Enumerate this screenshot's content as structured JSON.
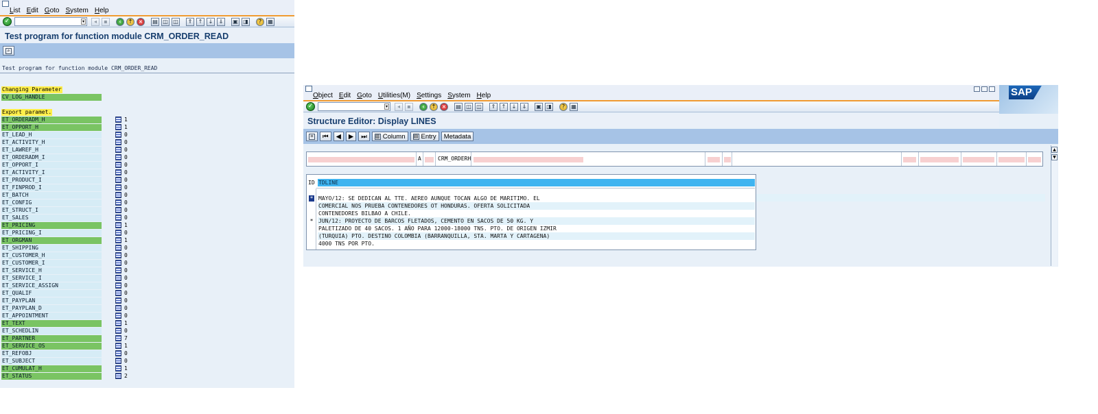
{
  "win1": {
    "menu": [
      "List",
      "Edit",
      "Goto",
      "System",
      "Help"
    ],
    "title": "Test program for function module CRM_ORDER_READ",
    "program_description": "Test program for function module CRM_ORDER_READ",
    "changing_label": "Changing Parameter",
    "changing_params": [
      {
        "name": "CV_LOG_HANDLE",
        "active": true
      }
    ],
    "export_label": "Export paramet.",
    "export_params": [
      {
        "name": "ET_ORDERADM_H",
        "count": "1",
        "active": true
      },
      {
        "name": "ET_OPPORT_H",
        "count": "1",
        "active": true
      },
      {
        "name": "ET_LEAD_H",
        "count": "0",
        "active": false
      },
      {
        "name": "ET_ACTIVITY_H",
        "count": "0",
        "active": false
      },
      {
        "name": "ET_LAWREF_H",
        "count": "0",
        "active": false
      },
      {
        "name": "ET_ORDERADM_I",
        "count": "0",
        "active": false
      },
      {
        "name": "ET_OPPORT_I",
        "count": "0",
        "active": false
      },
      {
        "name": "ET_ACTIVITY_I",
        "count": "0",
        "active": false
      },
      {
        "name": "ET_PRODUCT_I",
        "count": "0",
        "active": false
      },
      {
        "name": "ET_FINPROD_I",
        "count": "0",
        "active": false
      },
      {
        "name": "ET_BATCH",
        "count": "0",
        "active": false
      },
      {
        "name": "ET_CONFIG",
        "count": "0",
        "active": false
      },
      {
        "name": "ET_STRUCT_I",
        "count": "0",
        "active": false
      },
      {
        "name": "ET_SALES",
        "count": "0",
        "active": false
      },
      {
        "name": "ET_PRICING",
        "count": "1",
        "active": true
      },
      {
        "name": "ET_PRICING_I",
        "count": "0",
        "active": false
      },
      {
        "name": "ET_ORGMAN",
        "count": "1",
        "active": true
      },
      {
        "name": "ET_SHIPPING",
        "count": "0",
        "active": false
      },
      {
        "name": "ET_CUSTOMER_H",
        "count": "0",
        "active": false
      },
      {
        "name": "ET_CUSTOMER_I",
        "count": "0",
        "active": false
      },
      {
        "name": "ET_SERVICE_H",
        "count": "0",
        "active": false
      },
      {
        "name": "ET_SERVICE_I",
        "count": "0",
        "active": false
      },
      {
        "name": "ET_SERVICE_ASSIGN",
        "count": "0",
        "active": false
      },
      {
        "name": "ET_QUALIF",
        "count": "0",
        "active": false
      },
      {
        "name": "ET_PAYPLAN",
        "count": "0",
        "active": false
      },
      {
        "name": "ET_PAYPLAN_D",
        "count": "0",
        "active": false
      },
      {
        "name": "ET_APPOINTMENT",
        "count": "0",
        "active": false
      },
      {
        "name": "ET_TEXT",
        "count": "1",
        "active": true
      },
      {
        "name": "ET_SCHEDLIN",
        "count": "0",
        "active": false
      },
      {
        "name": "ET_PARTNER",
        "count": "7",
        "active": true
      },
      {
        "name": "ET_SERVICE_OS",
        "count": "1",
        "active": true
      },
      {
        "name": "ET_REFOBJ",
        "count": "0",
        "active": false
      },
      {
        "name": "ET_SUBJECT",
        "count": "0",
        "active": false
      },
      {
        "name": "ET_CUMULAT_H",
        "count": "1",
        "active": true
      },
      {
        "name": "ET_STATUS",
        "count": "2",
        "active": true
      }
    ]
  },
  "win2": {
    "menu": [
      "Object",
      "Edit",
      "Goto",
      "Utilities(M)",
      "Settings",
      "System",
      "Help"
    ],
    "logo_text": "SAP",
    "title": "Structure Editor: Display LINES",
    "buttons": {
      "column": "Column",
      "entry": "Entry",
      "metadata": "Metadata"
    },
    "header_labels": {
      "a": "A",
      "crm_orderh": "CRM_ORDERH"
    },
    "lines_header": {
      "id": "ID",
      "col": "TDLINE"
    },
    "lines": [
      {
        "mark": "*",
        "text": "MAYO/12: SE DEDICAN AL TTE. AEREO AUNQUE TOCAN ALGO DE MARITIMO. EL"
      },
      {
        "mark": "",
        "text": "COMERCIAL NOS PRUEBA CONTENEDORES OT HONDURAS. OFERTA SOLICITADA"
      },
      {
        "mark": "",
        "text": "CONTENEDORES BILBAO A CHILE."
      },
      {
        "mark": "*",
        "text": "JUN/12: PROYECTO DE BARCOS FLETADOS, CEMENTO EN SACOS DE 50 KG. Y"
      },
      {
        "mark": "",
        "text": "PALETIZADO DE 40 SACOS. 1 AÑO PARA 12000-18000 TNS. PTO. DE ORIGEN IZMIR"
      },
      {
        "mark": "",
        "text": "(TURQUIA) PTO. DESTINO COLOMBIA (BARRANQUILLA, STA. MARTA Y CARTAGENA)"
      },
      {
        "mark": "",
        "text": "4000 TNS POR PTO."
      }
    ]
  }
}
